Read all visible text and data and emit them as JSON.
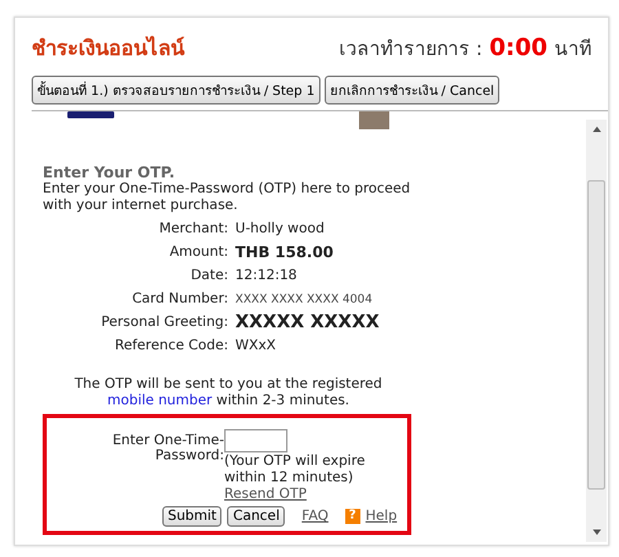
{
  "header": {
    "title": "ชำระเงินออนไลน์",
    "timer_label": "เวลาทำรายการ :",
    "timer_value": "0:00",
    "timer_unit": "นาที"
  },
  "steps": [
    {
      "label": "ขั้นตอนที่ 1.) ตรวจสอบรายการชำระเงิน / Step 1"
    },
    {
      "label": "ยกเลิกการชำระเงิน / Cancel"
    }
  ],
  "otp_page": {
    "heading": "Enter Your OTP.",
    "intro": "Enter your One-Time-Password (OTP) here to proceed with your internet purchase.",
    "details": [
      {
        "label": "Merchant:",
        "value": "U-holly wood",
        "kind": "plain"
      },
      {
        "label": "Amount:",
        "value": "THB 158.00",
        "kind": "bold"
      },
      {
        "label": "Date:",
        "value": "12:12:18",
        "kind": "plain"
      },
      {
        "label": "Card Number:",
        "value": "XXXX XXXX XXXX 4004",
        "kind": "small"
      },
      {
        "label": "Personal Greeting:",
        "value": "XXXXX  XXXXX",
        "kind": "large"
      },
      {
        "label": "Reference Code:",
        "value": "WXxX",
        "kind": "plain"
      }
    ],
    "notice_before": "The OTP will be sent to you at the registered",
    "notice_link": "mobile number",
    "notice_after": "within 2-3 minutes.",
    "form": {
      "label": "Enter One-Time-Password:",
      "hint": "(Your OTP will expire within 12 minutes)",
      "resend": "Resend OTP",
      "buttons": [
        "Submit",
        "Cancel"
      ],
      "faq": "FAQ",
      "help_icon": "?",
      "help": "Help"
    }
  }
}
